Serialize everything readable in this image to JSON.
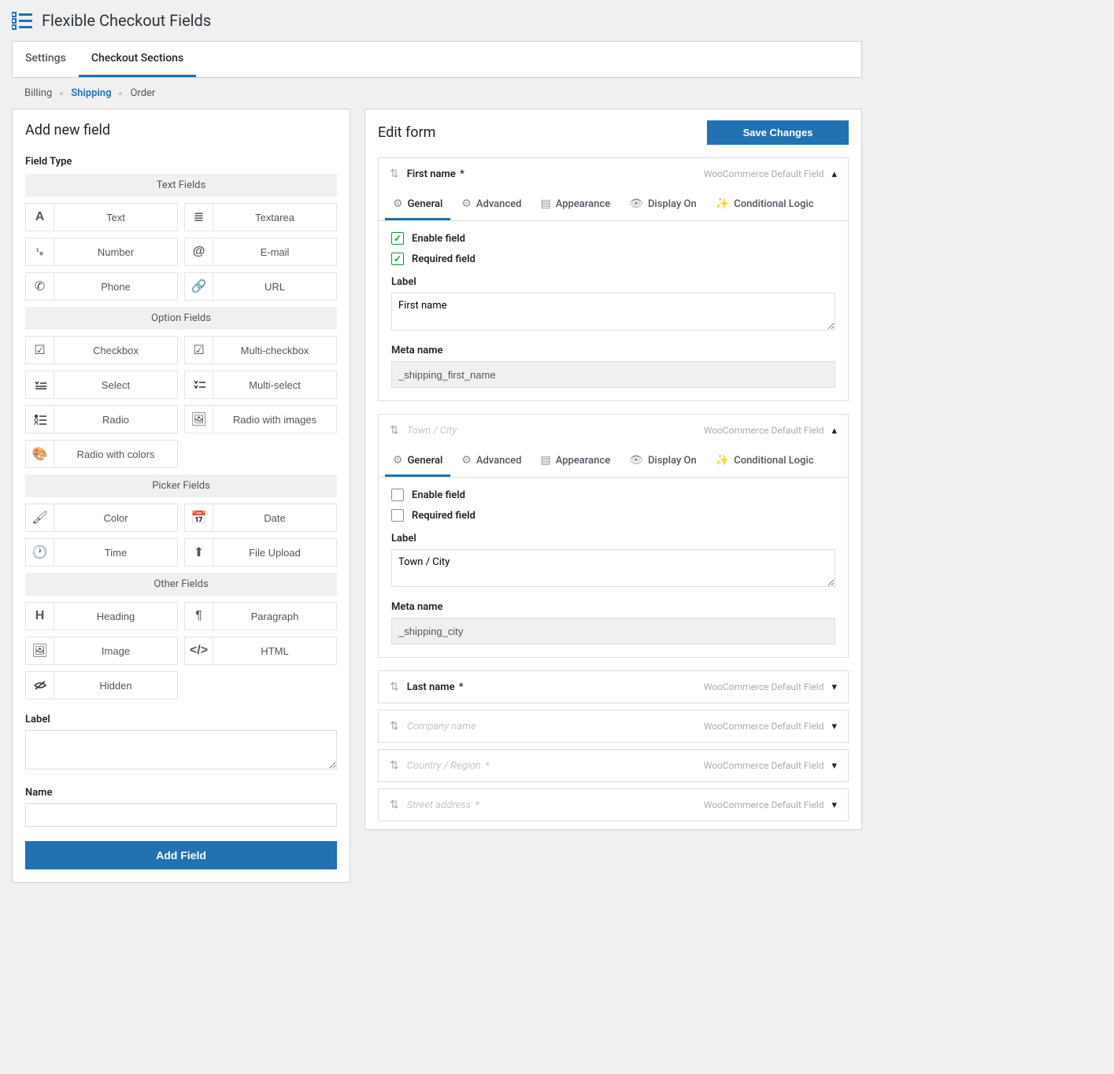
{
  "header": {
    "title": "Flexible Checkout Fields"
  },
  "navTabs": {
    "settings": "Settings",
    "sections": "Checkout Sections"
  },
  "subNav": {
    "billing": "Billing",
    "shipping": "Shipping",
    "order": "Order"
  },
  "left": {
    "panelTitle": "Add new field",
    "fieldTypeLabel": "Field Type",
    "groups": {
      "textFields": "Text Fields",
      "optionFields": "Option Fields",
      "pickerFields": "Picker Fields",
      "otherFields": "Other Fields"
    },
    "types": {
      "text": "Text",
      "textarea": "Textarea",
      "number": "Number",
      "email": "E-mail",
      "phone": "Phone",
      "url": "URL",
      "checkbox": "Checkbox",
      "multicheck": "Multi-checkbox",
      "select": "Select",
      "multiselect": "Multi-select",
      "radio": "Radio",
      "radioImages": "Radio with images",
      "radioColors": "Radio with colors",
      "color": "Color",
      "date": "Date",
      "time": "Time",
      "upload": "File Upload",
      "heading": "Heading",
      "paragraph": "Paragraph",
      "image": "Image",
      "html": "HTML",
      "hidden": "Hidden"
    },
    "labelLabel": "Label",
    "nameLabel": "Name",
    "addButton": "Add Field"
  },
  "right": {
    "panelTitle": "Edit form",
    "saveButton": "Save Changes",
    "defaultField": "WooCommerce Default Field",
    "tabs": {
      "general": "General",
      "advanced": "Advanced",
      "appearance": "Appearance",
      "displayOn": "Display On",
      "conditional": "Conditional Logic"
    },
    "checks": {
      "enable": "Enable field",
      "required": "Required field"
    },
    "labels": {
      "label": "Label",
      "metaName": "Meta name"
    },
    "field1": {
      "title": "First name",
      "required": "*",
      "labelVal": "First name",
      "metaVal": "_shipping_first_name"
    },
    "field2": {
      "title": "Town / City",
      "labelVal": "Town / City",
      "metaVal": "_shipping_city"
    },
    "field3": {
      "title": "Last name",
      "required": "*"
    },
    "field4": {
      "title": "Company name"
    },
    "field5": {
      "title": "Country / Region",
      "required": "*"
    },
    "field6": {
      "title": "Street address",
      "required": "*"
    }
  }
}
